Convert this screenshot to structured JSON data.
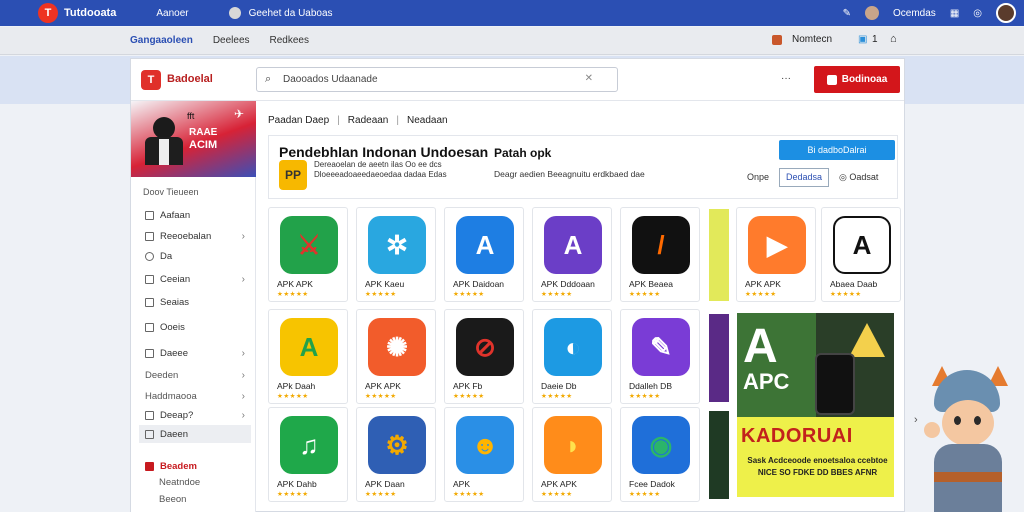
{
  "topbar": {
    "logo": "T",
    "brand": "Tutdooata",
    "link1": "Aanoer",
    "user_link": "Geehet da Uaboas",
    "right_label": "Ocemdas",
    "icons": [
      "wrench-icon",
      "grid-icon",
      "globe-icon",
      "avatar-icon"
    ]
  },
  "navbar2": {
    "item1": "Gangaaoleen",
    "item2": "Deelees",
    "item3": "Redkees",
    "right1": "Nomtecn",
    "right2": "1"
  },
  "header": {
    "logo": "T",
    "name": "Badoelal",
    "search_text": "Daooados Udaanade",
    "menu": "···",
    "cta_label": "Bodinoaa"
  },
  "sidebar": {
    "hero_small": "fft",
    "hero_line1": "RAAE",
    "hero_line2": "ACIM",
    "section_title": "Doov Tieueen",
    "items": [
      {
        "label": "Aafaan",
        "arrow": ""
      },
      {
        "label": "Reeoebalan",
        "arrow": "›"
      },
      {
        "label": "Da",
        "arrow": ""
      },
      {
        "label": "Ceeian",
        "arrow": "›"
      },
      {
        "label": "Seaias",
        "arrow": ""
      },
      {
        "label": "Ooeis",
        "arrow": ""
      },
      {
        "label": "Daeee",
        "arrow": "›"
      },
      {
        "label": "Deeden",
        "arrow": "›"
      },
      {
        "label": "Haddmaooa",
        "arrow": "›"
      },
      {
        "label": "Deeap?",
        "arrow": "›"
      },
      {
        "label": "Daeen",
        "arrow": ""
      },
      {
        "label": "Beadem",
        "arrow": ""
      },
      {
        "label": "Neatndoe",
        "arrow": ""
      },
      {
        "label": "Beeon",
        "arrow": ""
      }
    ]
  },
  "breadcrumb": [
    "Paadan Daep",
    "Radeaan",
    "Neadaan"
  ],
  "featured": {
    "title": "Pendebhlan Indonan Undoesan",
    "badge": "PP",
    "desc": "Dereaoelan de aeetn ilas Oo ee dcs Dloeeeadoaeedaeoedaa dadaa Edas",
    "subtitle": "Patah opk",
    "subdesc": "Deagr aedien Beeagnuitu erdkbaed dae",
    "primary_btn": "Bi dadboDalrai",
    "open_label": "Onpe",
    "secondary_btn": "Dedadsa",
    "more_label": "Oadsat"
  },
  "apps": [
    {
      "name": "APK APK",
      "glyph": "⚔",
      "color": "#e0332b",
      "bg": "#22a24a",
      "rating": 5
    },
    {
      "name": "APK Kaeu",
      "glyph": "✲",
      "color": "#ffffff",
      "bg": "#29a7e0",
      "rating": 5
    },
    {
      "name": "APK Daidoan",
      "glyph": "A",
      "color": "#ffffff",
      "bg": "#1e7ee3",
      "rating": 5
    },
    {
      "name": "APK Dddoaan",
      "glyph": "A",
      "color": "#ffffff",
      "bg": "#6b3ec7",
      "rating": 5
    },
    {
      "name": "APK Beaea",
      "glyph": "/",
      "color": "#ff6a00",
      "bg": "#111111",
      "rating": 5
    },
    {
      "name": "APK APK",
      "glyph": "▶",
      "color": "#ffffff",
      "bg": "#ff7b2c",
      "rating": 5
    },
    {
      "name": "Abaea Daab",
      "glyph": "A",
      "color": "#111111",
      "bg": "#ffffff",
      "rating": 5
    },
    {
      "name": "APk Daah",
      "glyph": "A",
      "color": "#22a24a",
      "bg": "#f7c400",
      "rating": 5
    },
    {
      "name": "APK APK",
      "glyph": "✺",
      "color": "#ffffff",
      "bg": "#f25c2b",
      "rating": 5
    },
    {
      "name": "APK Fb",
      "glyph": "⊘",
      "color": "#e0332b",
      "bg": "#1a1a1a",
      "rating": 5
    },
    {
      "name": "Daeie Db",
      "glyph": "◐",
      "color": "#ffffff",
      "bg": "#1d9ae3",
      "rating": 5
    },
    {
      "name": "Ddalleh DB",
      "glyph": "✎",
      "color": "#ffffff",
      "bg": "#7a3cd6",
      "rating": 5
    },
    {
      "name": "APK Dahb",
      "glyph": "♫",
      "color": "#ffffff",
      "bg": "#1fa84a",
      "rating": 5
    },
    {
      "name": "APK Daan",
      "glyph": "⚙",
      "color": "#f2a900",
      "bg": "#2f5fb4",
      "rating": 5
    },
    {
      "name": "APK",
      "glyph": "☻",
      "color": "#ffb400",
      "bg": "#2a8fe6",
      "rating": 5
    },
    {
      "name": "APK APK",
      "glyph": "◗",
      "color": "#ffe14d",
      "bg": "#ff8c1a",
      "rating": 5
    },
    {
      "name": "Fcee Dadok",
      "glyph": "◉",
      "color": "#2bb56a",
      "bg": "#1f6fd9",
      "rating": 5
    }
  ],
  "promo": {
    "big_letter": "A",
    "brand": "APC",
    "title": "KADORUAI",
    "desc": "Sask Acdceoode enoetsaloa ccebtoe NICE SO FDKE DD BBES AFNR"
  },
  "colors": {
    "topbar": "#2b4fb3",
    "accent_red": "#d3161b",
    "accent_blue": "#1c8fe3",
    "star": "#f2a900"
  }
}
